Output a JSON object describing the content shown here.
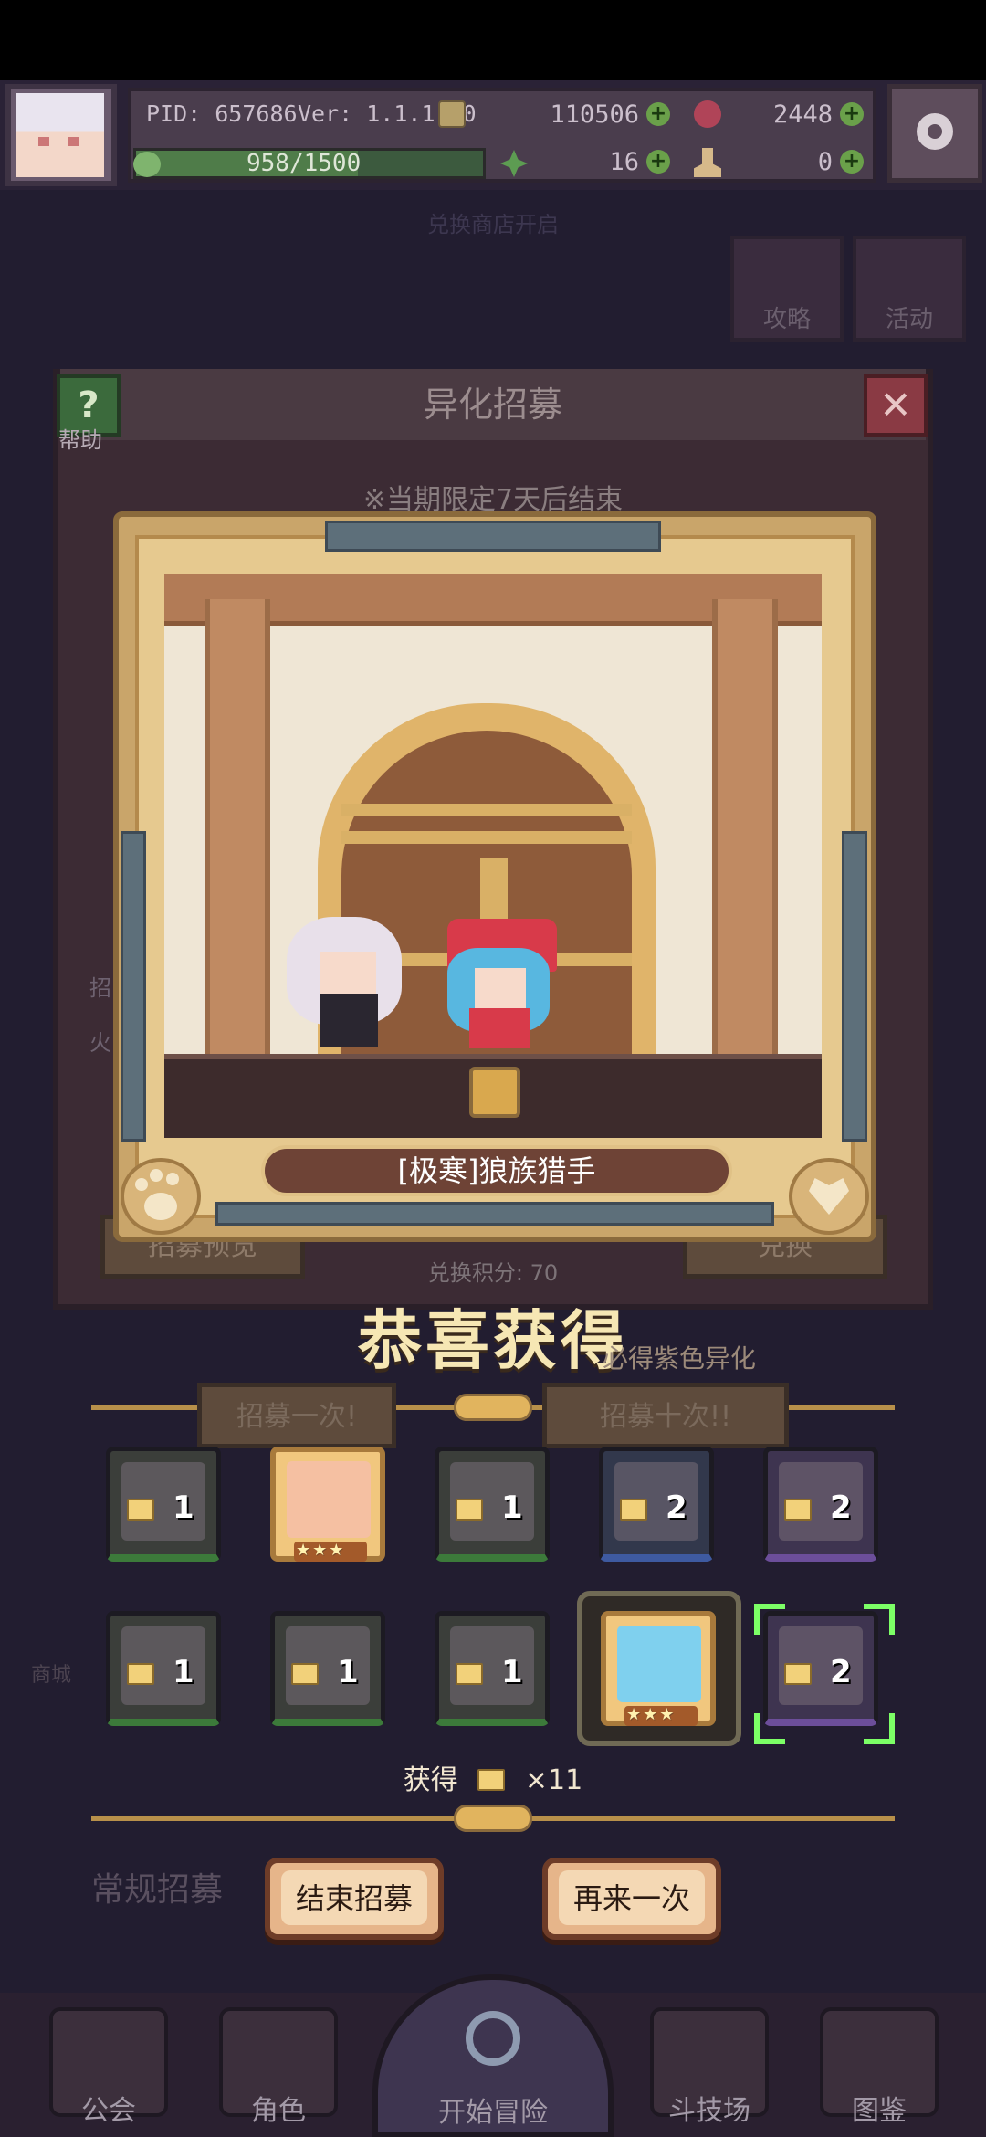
{
  "hud": {
    "pid": "PID: 657686",
    "ver": "Ver: 1.1.1.10",
    "gold": "110506",
    "gems": "2448",
    "exp": "958/1500",
    "exp_fraction": 0.639,
    "clover": "16",
    "boots": "0"
  },
  "background": {
    "top_banner": "兑换商店开启",
    "guide_label": "攻略",
    "activity_label": "活动",
    "dialog_title": "异化招募",
    "help_label": "帮助",
    "limited_note": "※当期限定7天后结束",
    "left_label_1": "招",
    "left_label_2": "火",
    "preview_btn": "招募预览",
    "exchange_btn": "兑换",
    "points": "兑换积分: 70",
    "guarantee": "必得紫色异化",
    "once_btn": "招募一次!",
    "ten_btn": "招募十次!!",
    "side_bottom": "商城",
    "regular_recruit": "常规招募"
  },
  "card": {
    "name": "[极寒]狼族猎手"
  },
  "result": {
    "title": "恭喜获得",
    "obtained_prefix": "获得",
    "obtained_count": "×11"
  },
  "rewards": {
    "row1": [
      {
        "label": "1",
        "rarity": "green"
      },
      {
        "label": "★★★",
        "rarity": "gold"
      },
      {
        "label": "1",
        "rarity": "green"
      },
      {
        "label": "2",
        "rarity": "blue"
      },
      {
        "label": "2",
        "rarity": "purple"
      }
    ],
    "row2": [
      {
        "label": "1",
        "rarity": "green"
      },
      {
        "label": "1",
        "rarity": "green"
      },
      {
        "label": "1",
        "rarity": "green"
      },
      {
        "label": "★★★",
        "rarity": "gold"
      },
      {
        "label": "2",
        "rarity": "purple"
      }
    ]
  },
  "actions": {
    "end": "结束招募",
    "again": "再来一次"
  },
  "nav": {
    "guild": "公会",
    "role": "角色",
    "start": "开始冒险",
    "arena": "斗技场",
    "codex": "图鉴"
  },
  "colors": {
    "accent_gold": "#e1b45e",
    "highlight_green": "#7cff66"
  }
}
